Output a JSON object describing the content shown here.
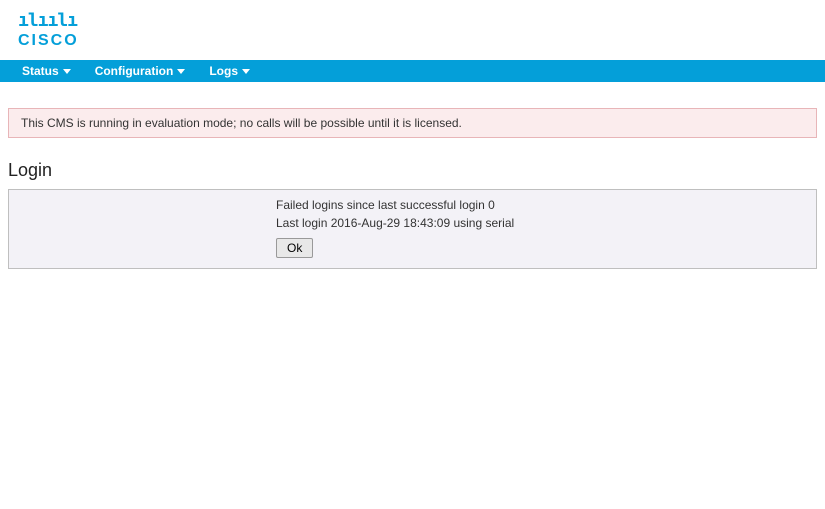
{
  "brand": {
    "logo_bars": "ılıılı",
    "logo_text": "CISCO"
  },
  "navbar": {
    "items": [
      {
        "label": "Status"
      },
      {
        "label": "Configuration"
      },
      {
        "label": "Logs"
      }
    ]
  },
  "notice": {
    "text": "This CMS is running in evaluation mode; no calls will be possible until it is licensed."
  },
  "page": {
    "title": "Login"
  },
  "login_panel": {
    "failed_logins_line": "Failed logins since last successful login 0",
    "last_login_line": "Last login 2016-Aug-29 18:43:09 using serial",
    "ok_label": "Ok"
  }
}
